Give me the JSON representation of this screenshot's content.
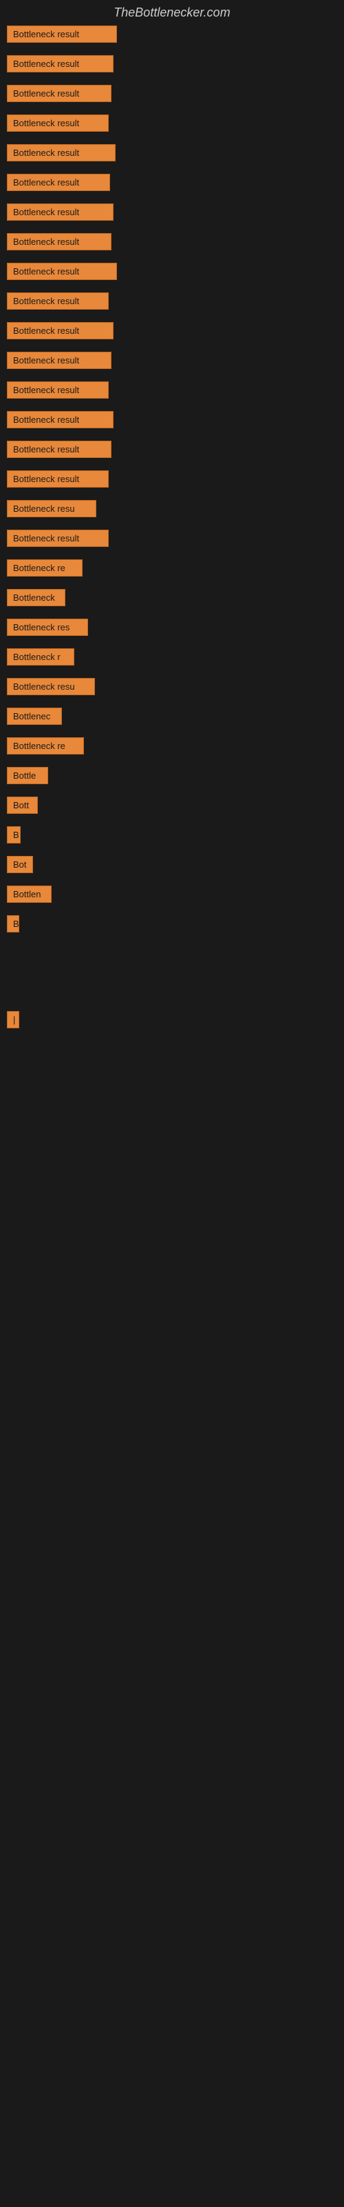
{
  "site": {
    "title": "TheBottlenecker.com"
  },
  "items": [
    {
      "label": "Bottleneck result",
      "width": 160
    },
    {
      "label": "Bottleneck result",
      "width": 155
    },
    {
      "label": "Bottleneck result",
      "width": 152
    },
    {
      "label": "Bottleneck result",
      "width": 148
    },
    {
      "label": "Bottleneck result",
      "width": 158
    },
    {
      "label": "Bottleneck result",
      "width": 150
    },
    {
      "label": "Bottleneck result",
      "width": 155
    },
    {
      "label": "Bottleneck result",
      "width": 152
    },
    {
      "label": "Bottleneck result",
      "width": 160
    },
    {
      "label": "Bottleneck result",
      "width": 148
    },
    {
      "label": "Bottleneck result",
      "width": 155
    },
    {
      "label": "Bottleneck result",
      "width": 152
    },
    {
      "label": "Bottleneck result",
      "width": 148
    },
    {
      "label": "Bottleneck result",
      "width": 155
    },
    {
      "label": "Bottleneck result",
      "width": 152
    },
    {
      "label": "Bottleneck result",
      "width": 148
    },
    {
      "label": "Bottleneck resu",
      "width": 130
    },
    {
      "label": "Bottleneck result",
      "width": 148
    },
    {
      "label": "Bottleneck re",
      "width": 110
    },
    {
      "label": "Bottleneck",
      "width": 85
    },
    {
      "label": "Bottleneck res",
      "width": 118
    },
    {
      "label": "Bottleneck r",
      "width": 98
    },
    {
      "label": "Bottleneck resu",
      "width": 128
    },
    {
      "label": "Bottlenec",
      "width": 80
    },
    {
      "label": "Bottleneck re",
      "width": 112
    },
    {
      "label": "Bottle",
      "width": 60
    },
    {
      "label": "Bott",
      "width": 45
    },
    {
      "label": "B",
      "width": 20
    },
    {
      "label": "Bot",
      "width": 38
    },
    {
      "label": "Bottlen",
      "width": 65
    },
    {
      "label": "B",
      "width": 18
    },
    {
      "label": "",
      "width": 0
    },
    {
      "label": "",
      "width": 0
    },
    {
      "label": "|",
      "width": 10
    },
    {
      "label": "",
      "width": 0
    },
    {
      "label": "",
      "width": 0
    },
    {
      "label": "",
      "width": 6
    }
  ]
}
